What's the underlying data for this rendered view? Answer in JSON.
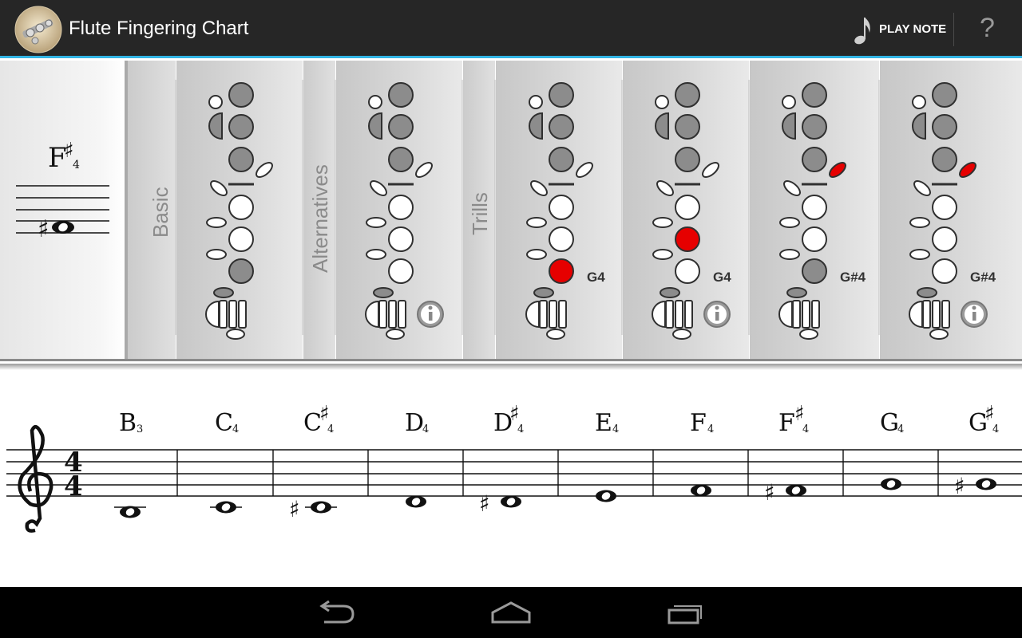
{
  "app": {
    "title": "Flute Fingering Chart",
    "play_note_label": "PLAY NOTE",
    "help_label": "?"
  },
  "selected_note": {
    "letter": "F",
    "accidental": "♯",
    "octave": "4"
  },
  "sections": {
    "basic": "Basic",
    "alternatives": "Alternatives",
    "trills": "Trills"
  },
  "fingerings": [
    {
      "section": "basic",
      "keys": [
        "b",
        "-",
        "b",
        "w",
        "-",
        "w",
        "w",
        "b",
        "-",
        "w",
        "w",
        "w"
      ],
      "trill_label": "",
      "has_info": false
    },
    {
      "section": "alternatives",
      "keys": [
        "b",
        "-",
        "b",
        "w",
        "-",
        "w",
        "b",
        "w",
        "-",
        "w",
        "w",
        "w"
      ],
      "trill_label": "",
      "has_info": true
    },
    {
      "section": "trills",
      "keys": [
        "b",
        "-",
        "b",
        "w",
        "-",
        "w",
        "w",
        "r",
        "-",
        "w",
        "w",
        "w"
      ],
      "trill_label": "G4",
      "has_info": false
    },
    {
      "section": "trills",
      "keys": [
        "b",
        "-",
        "b",
        "w",
        "-",
        "r",
        "w",
        "w",
        "-",
        "w",
        "w",
        "w"
      ],
      "trill_label": "G4",
      "has_info": true
    },
    {
      "section": "trills",
      "keys": [
        "b",
        "r",
        "b",
        "w",
        "-",
        "w",
        "w",
        "b",
        "-",
        "w",
        "w",
        "w"
      ],
      "trill_label": "G#4",
      "has_info": false
    },
    {
      "section": "trills",
      "keys": [
        "b",
        "r",
        "b",
        "w",
        "-",
        "w",
        "b",
        "w",
        "-",
        "w",
        "w",
        "w"
      ],
      "trill_label": "G#4",
      "has_info": true
    }
  ],
  "fingering_key_legend": [
    "thumb-top",
    "trill-1-side",
    "left-index",
    "left-middle",
    "trill-2-side",
    "left-ring",
    "right-index",
    "right-middle",
    "right-ring",
    "foot-d",
    "foot-c",
    "foot-b"
  ],
  "notes": [
    {
      "letter": "B",
      "accidental": "",
      "octave": "3"
    },
    {
      "letter": "C",
      "accidental": "",
      "octave": "4"
    },
    {
      "letter": "C",
      "accidental": "♯",
      "octave": "4"
    },
    {
      "letter": "D",
      "accidental": "",
      "octave": "4"
    },
    {
      "letter": "D",
      "accidental": "♯",
      "octave": "4"
    },
    {
      "letter": "E",
      "accidental": "",
      "octave": "4"
    },
    {
      "letter": "F",
      "accidental": "",
      "octave": "4"
    },
    {
      "letter": "F",
      "accidental": "♯",
      "octave": "4"
    },
    {
      "letter": "G",
      "accidental": "",
      "octave": "4"
    },
    {
      "letter": "G",
      "accidental": "♯",
      "octave": "4"
    }
  ],
  "time_signature": {
    "top": "4",
    "bottom": "4"
  },
  "icons": {
    "app": "flute-keys-icon",
    "play": "eighth-note-icon",
    "info": "info-icon",
    "back": "back-arrow-icon",
    "home": "home-icon",
    "recents": "recent-apps-icon",
    "clef": "treble-clef-icon"
  },
  "colors": {
    "action_bar": "#262626",
    "accent": "#33b5e5",
    "key_closed": "#8c8c8c",
    "key_open": "#ffffff",
    "key_trill": "#e60000"
  }
}
